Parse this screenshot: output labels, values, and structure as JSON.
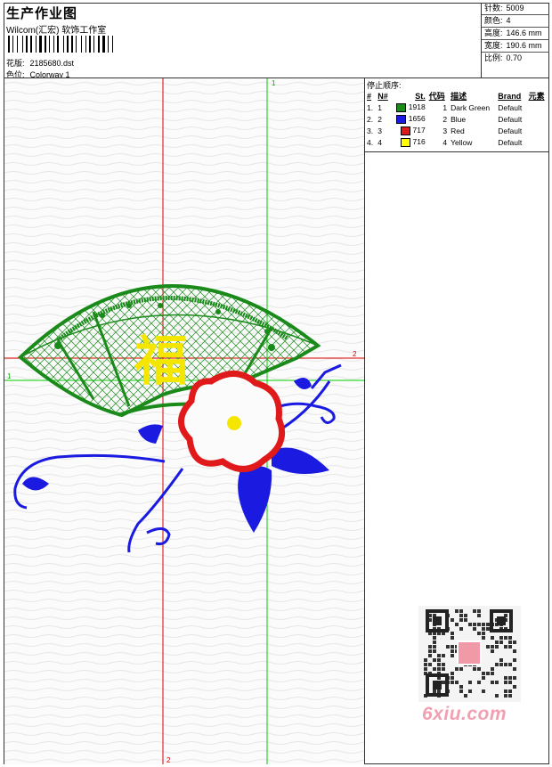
{
  "header": {
    "title": "生产作业图",
    "company": "Wilcom(汇宏) 软饰工作室",
    "pattern_label": "花版:",
    "pattern_value": "2185680.dst",
    "colorway_label": "色位:",
    "colorway_value": "Colorway 1"
  },
  "stats": [
    {
      "label": "针数:",
      "value": "5009"
    },
    {
      "label": "颜色:",
      "value": "4"
    },
    {
      "label": "高度:",
      "value": "146.6 mm"
    },
    {
      "label": "宽度:",
      "value": "190.6 mm"
    },
    {
      "label": "比例:",
      "value": "0.70"
    }
  ],
  "stop_sequence": {
    "title": "停止顺序:",
    "columns": [
      "#",
      "N#",
      "St.",
      "代码",
      "描述",
      "Brand",
      "元素"
    ],
    "rows": [
      {
        "index": "1.",
        "n": "1",
        "stitches": "1918",
        "code": "1",
        "desc": "Dark Green",
        "brand": "Default",
        "color": "#1a8a1a"
      },
      {
        "index": "2.",
        "n": "2",
        "stitches": "1656",
        "code": "2",
        "desc": "Blue",
        "brand": "Default",
        "color": "#1a1ae0"
      },
      {
        "index": "3.",
        "n": "3",
        "stitches": "717",
        "code": "3",
        "desc": "Red",
        "brand": "Default",
        "color": "#e01a1a"
      },
      {
        "index": "4.",
        "n": "4",
        "stitches": "716",
        "code": "4",
        "desc": "Yellow",
        "brand": "Default",
        "color": "#ffff00"
      }
    ]
  },
  "design": {
    "axis_label_1": "1",
    "axis_label_2": "2",
    "hanzi": "福",
    "colors": {
      "green": "#1a8a1a",
      "blue": "#1a1ae0",
      "red": "#e01a1a",
      "yellow": "#f5e600",
      "guide_red": "#dd0000",
      "guide_green": "#00cc00"
    }
  },
  "watermark": {
    "text": "6xiu.com",
    "icon": "qr-code-icon"
  }
}
